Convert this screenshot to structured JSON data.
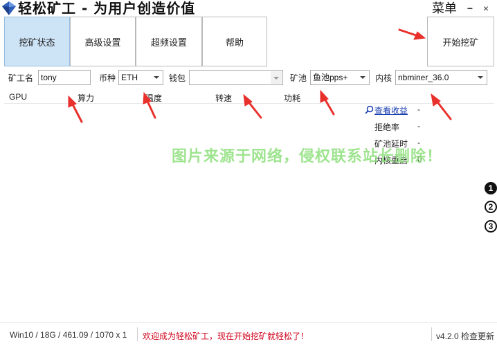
{
  "titlebar": {
    "title": "轻松矿工 - 为用户创造价值",
    "menu": "菜单",
    "minimize": "−",
    "close": "×"
  },
  "tabs": [
    {
      "label": "挖矿状态",
      "active": true
    },
    {
      "label": "高级设置",
      "active": false
    },
    {
      "label": "超频设置",
      "active": false
    },
    {
      "label": "帮助",
      "active": false
    }
  ],
  "start_button": "开始挖矿",
  "config": {
    "miner_name_label": "矿工名",
    "miner_name_value": "tony",
    "coin_label": "币种",
    "coin_value": "ETH",
    "wallet_label": "钱包",
    "wallet_value": "",
    "pool_label": "矿池",
    "pool_value": "鱼池pps+",
    "kernel_label": "内核",
    "kernel_value": "nbminer_36.0"
  },
  "table": {
    "columns": [
      "GPU",
      "算力",
      "温度",
      "转速",
      "功耗"
    ]
  },
  "stats": {
    "view_earnings": "查看收益",
    "view_earnings_value": "-",
    "reject_rate_label": "拒绝率",
    "reject_rate_value": "-",
    "pool_latency_label": "矿池延时",
    "pool_latency_value": "-",
    "kernel_restart_label": "内核重启",
    "kernel_restart_value": "0"
  },
  "watermark": "图片来源于网络，侵权联系站长删除！",
  "side_buttons": [
    "1",
    "2",
    "3"
  ],
  "statusbar": {
    "system_info": "Win10  / 18G / 461.09 / 1070 x 1",
    "welcome": "欢迎成为轻松矿工，现在开始挖矿就轻松了！",
    "version": "v4.2.0 检查更新"
  },
  "colors": {
    "active_tab": "#cde3f6",
    "arrow": "#e8312c",
    "watermark": "#8ee07c",
    "welcome_text": "#d0021b"
  }
}
